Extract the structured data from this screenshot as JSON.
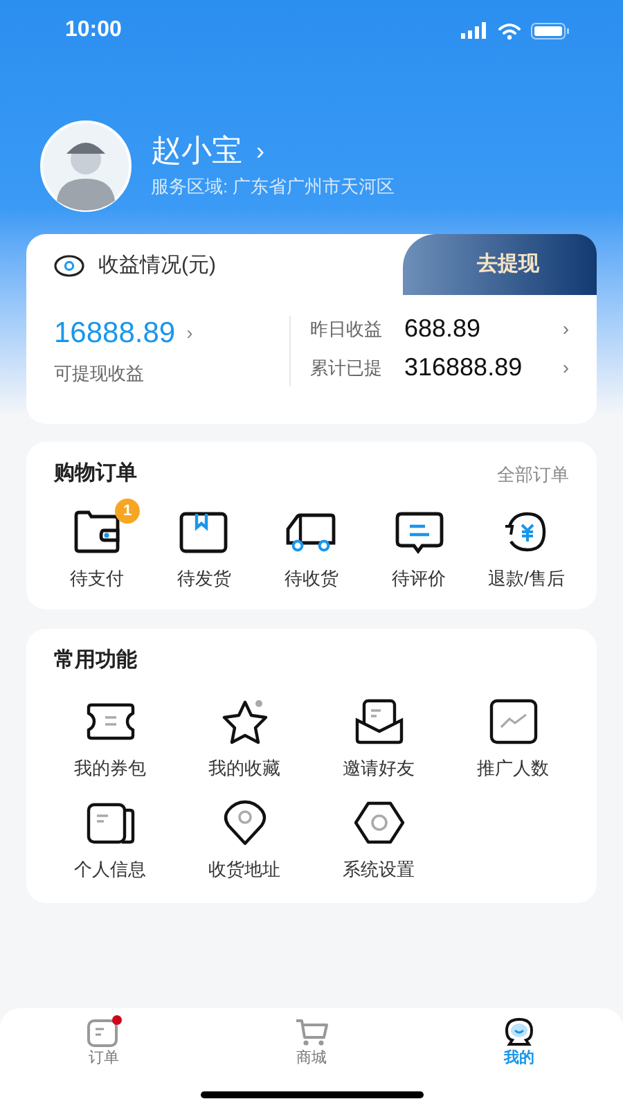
{
  "status_bar": {
    "time": "10:00"
  },
  "profile": {
    "name": "赵小宝",
    "chevron": "›",
    "area": "服务区域: 广东省广州市天河区"
  },
  "earnings": {
    "title": "收益情况(元)",
    "withdraw_button": "去提现",
    "available": "16888.89",
    "available_chevron": "›",
    "available_label": "可提现收益",
    "stats": [
      {
        "label": "昨日收益",
        "value": "688.89",
        "chevron": "›"
      },
      {
        "label": "累计已提",
        "value": "316888.89",
        "chevron": "›"
      }
    ]
  },
  "orders": {
    "title": "购物订单",
    "all_link": "全部订单",
    "items": [
      {
        "label": "待支付",
        "badge": "1"
      },
      {
        "label": "待发货"
      },
      {
        "label": "待收货"
      },
      {
        "label": "待评价"
      },
      {
        "label": "退款/售后"
      }
    ]
  },
  "functions": {
    "title": "常用功能",
    "items": [
      {
        "label": "我的券包"
      },
      {
        "label": "我的收藏"
      },
      {
        "label": "邀请好友"
      },
      {
        "label": "推广人数"
      },
      {
        "label": "个人信息"
      },
      {
        "label": "收货地址"
      },
      {
        "label": "系统设置"
      }
    ]
  },
  "tab_bar": [
    {
      "label": "订单",
      "selected": false,
      "has_notice": true
    },
    {
      "label": "商城",
      "selected": false,
      "has_notice": false
    },
    {
      "label": "我的",
      "selected": true,
      "has_notice": false
    }
  ]
}
